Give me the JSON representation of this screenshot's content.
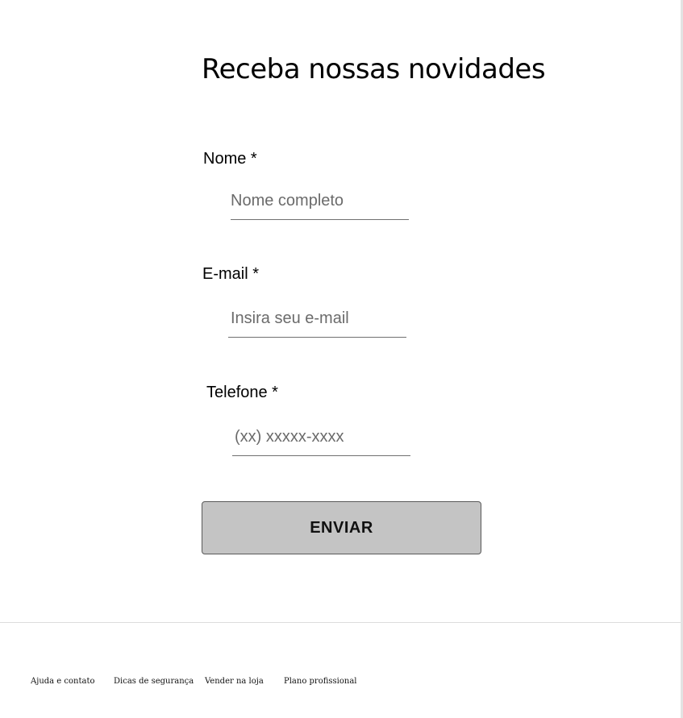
{
  "form": {
    "title": "Receba nossas novidades",
    "fields": [
      {
        "label": "Nome *",
        "placeholder": "Nome completo",
        "value": ""
      },
      {
        "label": "E-mail *",
        "placeholder": "Insira seu e-mail",
        "value": ""
      },
      {
        "label": "Telefone *",
        "placeholder": "(xx) xxxxx-xxxx",
        "value": ""
      }
    ],
    "submit_label": "ENVIAR"
  },
  "footer": {
    "links": [
      {
        "label": "Ajuda e contato"
      },
      {
        "label": "Dicas de segurança"
      },
      {
        "label": "Vender na loja"
      },
      {
        "label": "Plano profissional"
      }
    ]
  }
}
